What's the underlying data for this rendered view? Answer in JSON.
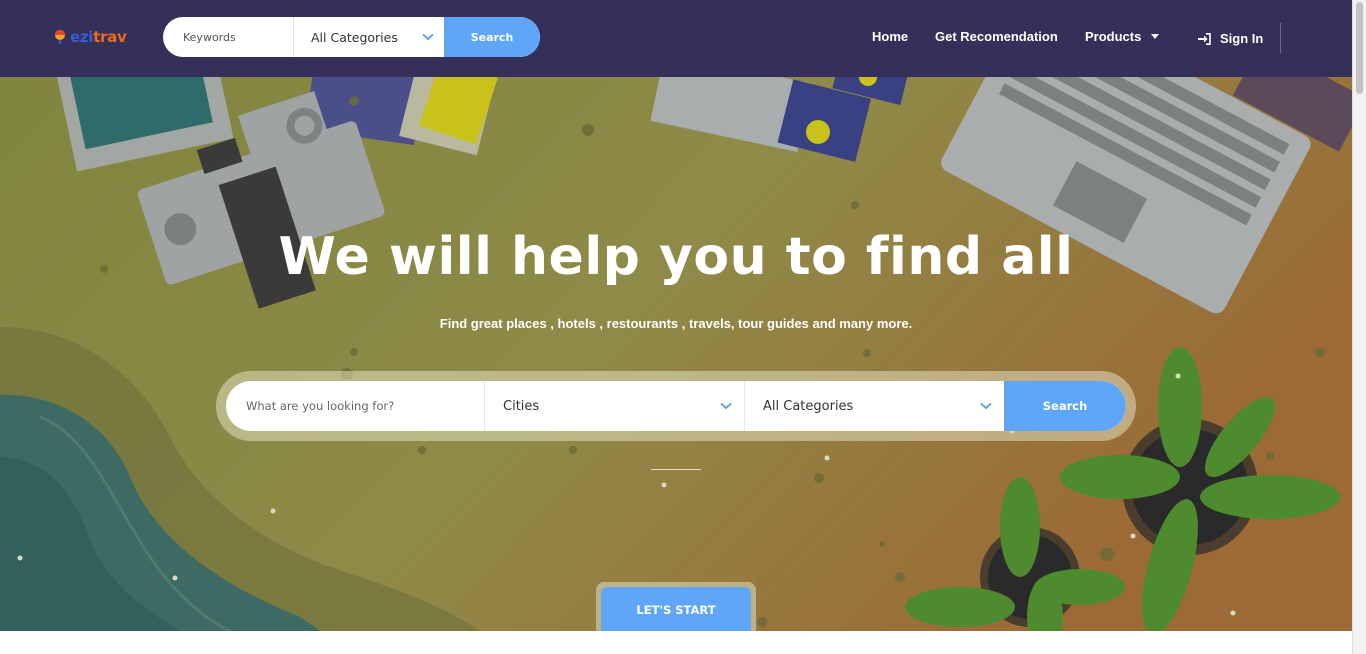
{
  "logo": {
    "part1": "ezi",
    "part2": "trav"
  },
  "header_search": {
    "keyword_placeholder": "Keywords",
    "category": "All Categories",
    "button": "Search"
  },
  "nav": {
    "home": "Home",
    "recommendation": "Get Recomendation",
    "products": "Products",
    "sign_in": "Sign In"
  },
  "hero": {
    "title": "We will help you to find all",
    "subtitle": "Find great places , hotels , restourants , travels, tour guides and many more.",
    "search": {
      "query_placeholder": "What are you looking for?",
      "city": "Cities",
      "category": "All Categories",
      "button": "Search"
    },
    "start_button": "LET'S START"
  },
  "colors": {
    "header_bg": "#34305a",
    "accent_blue": "#5fa5f8",
    "hero_olive": "#8f8a4a",
    "logo_blue": "#3b5bd6",
    "logo_orange": "#f06a1c"
  },
  "icons": [
    "logo-mark-icon",
    "chevron-down-icon",
    "caret-down-icon",
    "sign-in-icon"
  ]
}
